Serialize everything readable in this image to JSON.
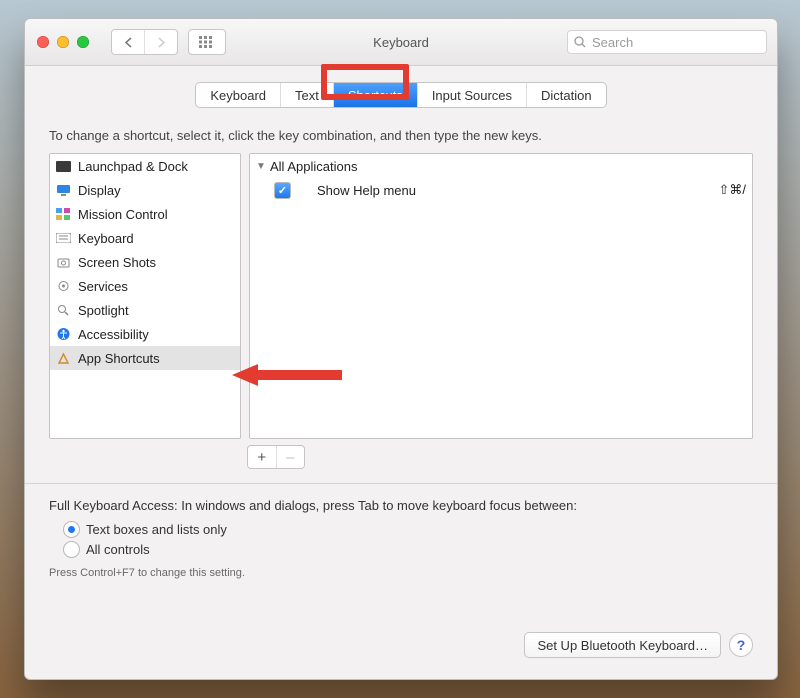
{
  "window": {
    "title": "Keyboard"
  },
  "search": {
    "placeholder": "Search"
  },
  "tabs": [
    {
      "label": "Keyboard",
      "active": false
    },
    {
      "label": "Text",
      "active": false
    },
    {
      "label": "Shortcuts",
      "active": true
    },
    {
      "label": "Input Sources",
      "active": false
    },
    {
      "label": "Dictation",
      "active": false
    }
  ],
  "instruction": "To change a shortcut, select it, click the key combination, and then type the new keys.",
  "categories": [
    {
      "label": "Launchpad & Dock",
      "icon": "launchpad",
      "selected": false
    },
    {
      "label": "Display",
      "icon": "display",
      "selected": false
    },
    {
      "label": "Mission Control",
      "icon": "mission",
      "selected": false
    },
    {
      "label": "Keyboard",
      "icon": "keyboard",
      "selected": false
    },
    {
      "label": "Screen Shots",
      "icon": "screenshots",
      "selected": false
    },
    {
      "label": "Services",
      "icon": "services",
      "selected": false
    },
    {
      "label": "Spotlight",
      "icon": "spotlight",
      "selected": false
    },
    {
      "label": "Accessibility",
      "icon": "accessibility",
      "selected": false
    },
    {
      "label": "App Shortcuts",
      "icon": "apps",
      "selected": true
    }
  ],
  "shortcuts": {
    "group": "All Applications",
    "items": [
      {
        "checked": true,
        "label": "Show Help menu",
        "keys": "⇧⌘/"
      }
    ]
  },
  "buttons": {
    "add": "+",
    "remove": "–"
  },
  "fka": {
    "heading": "Full Keyboard Access: In windows and dialogs, press Tab to move keyboard focus between:",
    "opt1": "Text boxes and lists only",
    "opt2": "All controls",
    "hint": "Press Control+F7 to change this setting."
  },
  "bluetooth_button": "Set Up Bluetooth Keyboard…",
  "help_button": "?"
}
